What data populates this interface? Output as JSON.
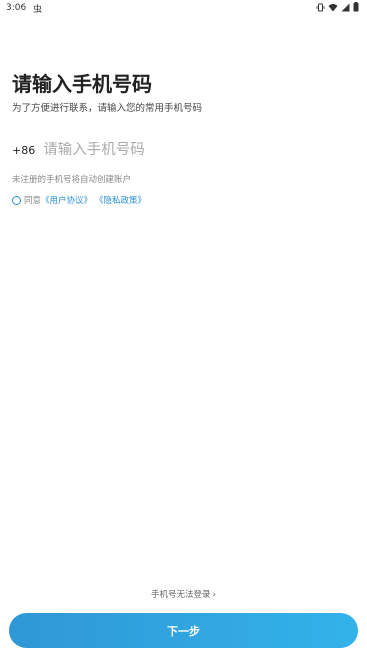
{
  "status_bar": {
    "time": "3:06",
    "app_icon": "虫",
    "icons": [
      "vibrate-icon",
      "wifi-icon",
      "signal-icon",
      "battery-icon"
    ]
  },
  "page": {
    "title": "请输入手机号码",
    "subtitle": "为了方便进行联系，请输入您的常用手机号码"
  },
  "phone": {
    "country_code": "+86",
    "placeholder": "请输入手机号码",
    "value": ""
  },
  "hint": "未注册的手机号将自动创建账户",
  "agreement": {
    "prefix": "同意",
    "user_agreement": "《用户协议》",
    "privacy_policy": "《隐私政策》"
  },
  "footer": {
    "cannot_login": "手机号无法登录",
    "next_button": "下一步"
  },
  "colors": {
    "accent": "#2a8fd4",
    "button_gradient_start": "#2f97d6",
    "button_gradient_end": "#33b2ea"
  }
}
